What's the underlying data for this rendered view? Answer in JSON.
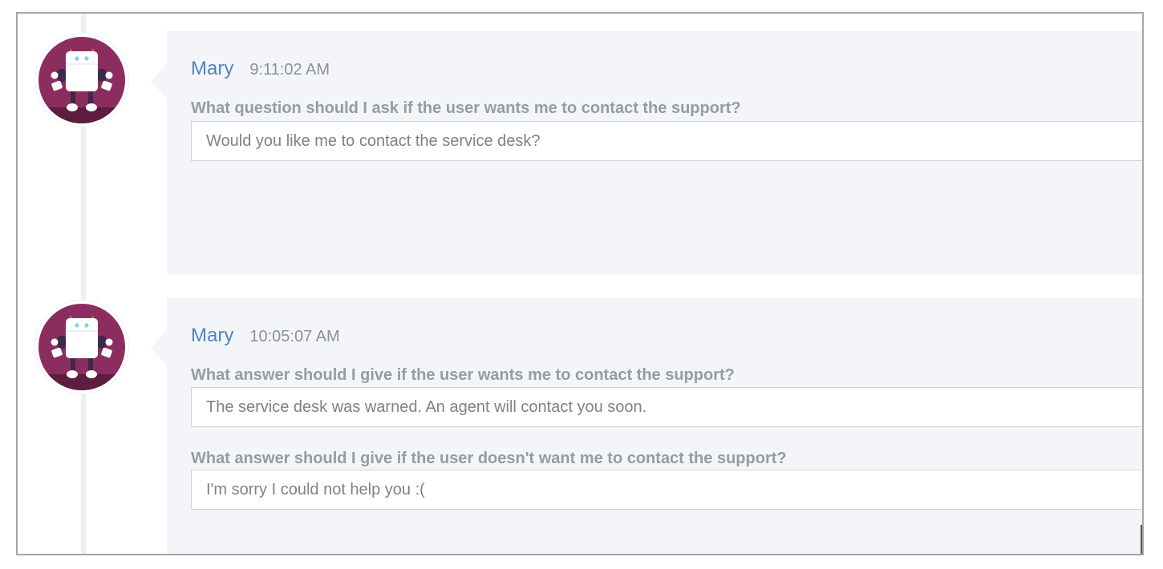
{
  "colors": {
    "author": "#4f86bd",
    "timestamp": "#8a9299",
    "question": "#929ea0",
    "answer_text": "#7b8388",
    "bubble_bg": "#f4f5f9",
    "avatar_bg": "#8c2d5f"
  },
  "messages": [
    {
      "author": "Mary",
      "time": "9:11:02 AM",
      "avatar_icon": "robot-icon",
      "fields": [
        {
          "question": "What question should I ask if the user wants me to contact the support?",
          "answer": "Would you like me to contact the service desk?"
        }
      ]
    },
    {
      "author": "Mary",
      "time": "10:05:07 AM",
      "avatar_icon": "robot-icon",
      "fields": [
        {
          "question": "What answer should I give if the user wants me to contact the support?",
          "answer": "The service desk was warned. An agent will contact you soon."
        },
        {
          "question": "What answer should I give if the user doesn't want me to contact the support?",
          "answer": "I'm sorry I could not help you :("
        }
      ]
    }
  ]
}
